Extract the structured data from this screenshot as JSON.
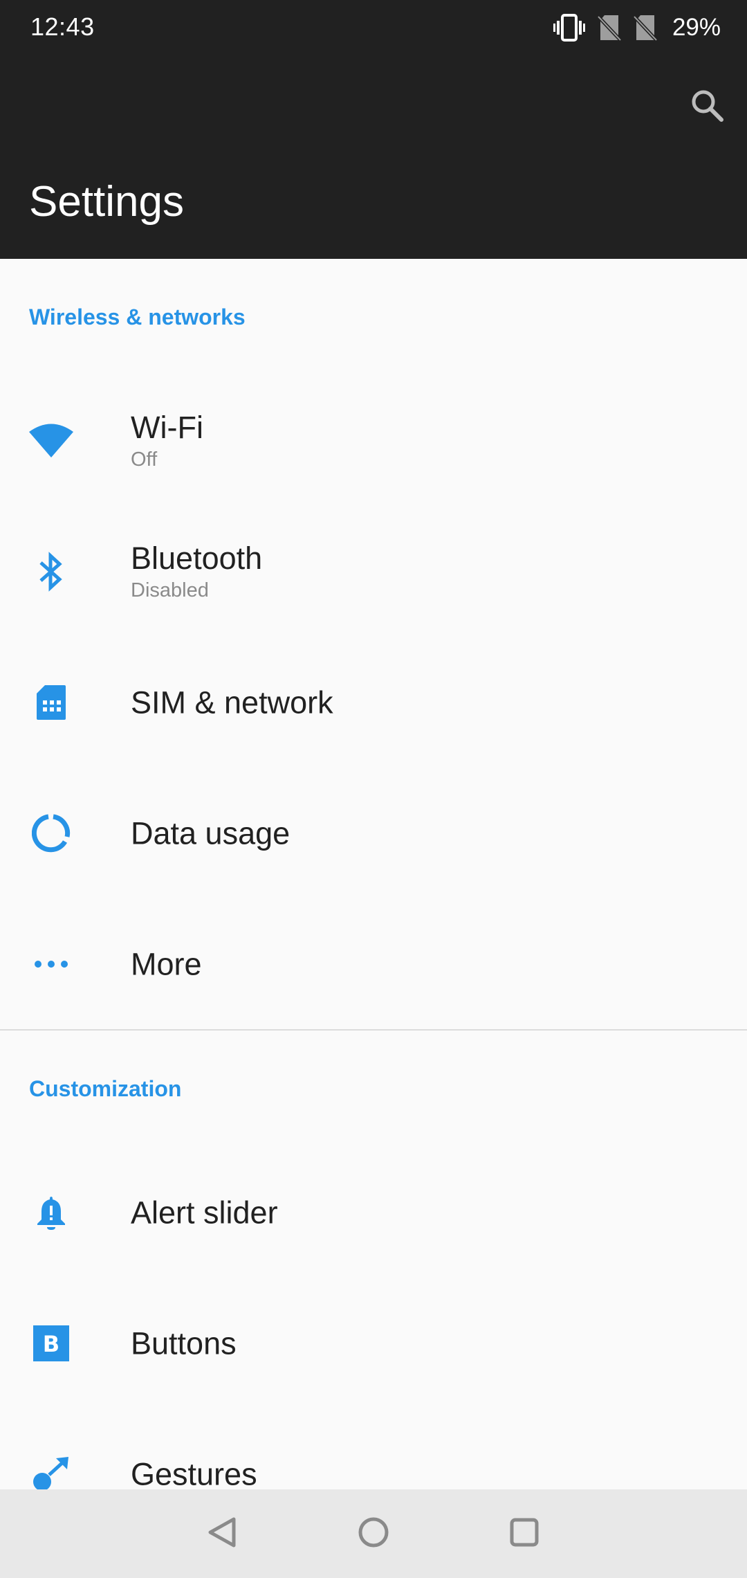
{
  "status_bar": {
    "time": "12:43",
    "battery": "29%",
    "icons": [
      "vibrate-icon",
      "no-sim-icon",
      "no-sim-icon"
    ]
  },
  "toolbar": {
    "title": "Settings",
    "search_icon": "search-icon"
  },
  "sections": [
    {
      "header": "Wireless & networks",
      "items": [
        {
          "title": "Wi-Fi",
          "subtitle": "Off",
          "icon": "wifi-icon"
        },
        {
          "title": "Bluetooth",
          "subtitle": "Disabled",
          "icon": "bluetooth-icon"
        },
        {
          "title": "SIM & network",
          "icon": "sim-card-icon"
        },
        {
          "title": "Data usage",
          "icon": "data-usage-icon"
        },
        {
          "title": "More",
          "icon": "more-horiz-icon"
        }
      ]
    },
    {
      "header": "Customization",
      "items": [
        {
          "title": "Alert slider",
          "icon": "bell-icon"
        },
        {
          "title": "Buttons",
          "icon": "buttons-b-icon"
        },
        {
          "title": "Gestures",
          "icon": "gestures-icon"
        }
      ]
    }
  ],
  "nav_bar": {
    "buttons": [
      "back-icon",
      "home-icon",
      "recents-icon"
    ]
  },
  "colors": {
    "accent": "#2793e6",
    "toolbar_bg": "#212121",
    "background": "#fafafa",
    "nav_bg": "#e8e8e8"
  }
}
